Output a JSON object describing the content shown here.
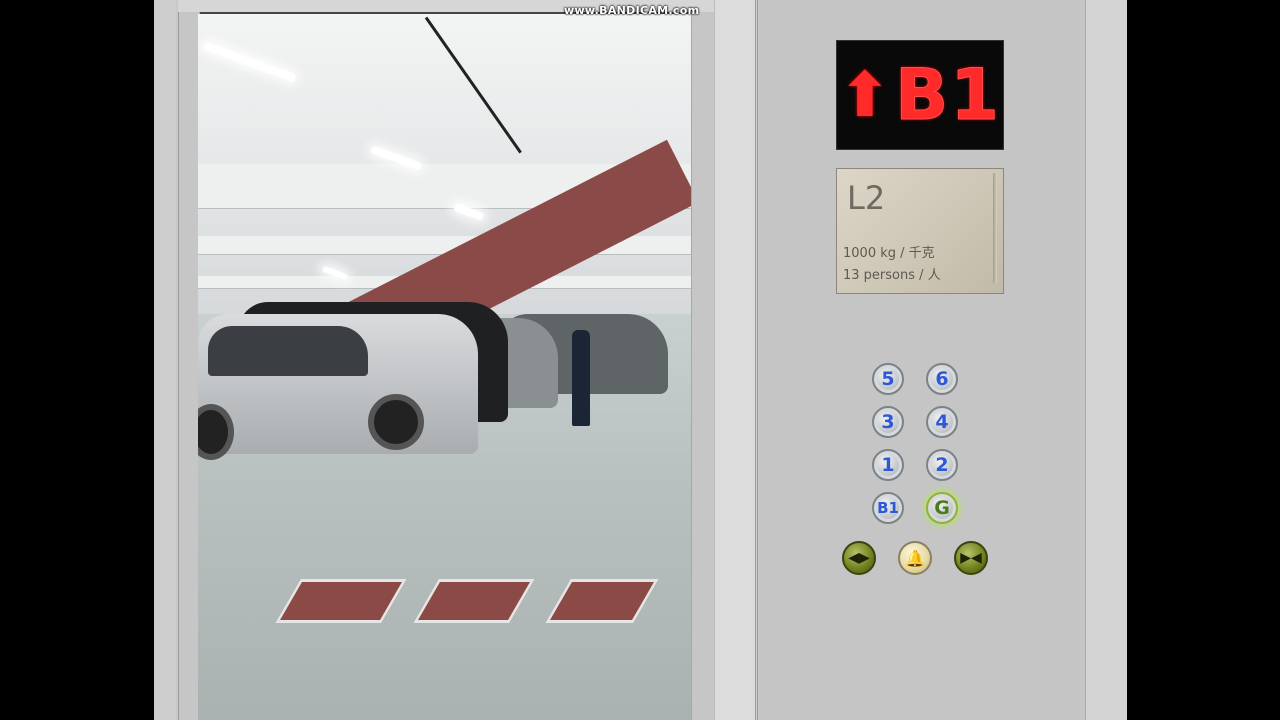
{
  "watermark": "www.BANDICAM.com",
  "indicator": {
    "direction_arrow": "⬆",
    "floor": "B1",
    "color": "#ff2a2a"
  },
  "capacity_plate": {
    "floor_label": "L2",
    "load": "1000 kg / 千克",
    "persons": "13 persons / 人"
  },
  "floor_buttons": [
    {
      "label": "5",
      "lit": false
    },
    {
      "label": "6",
      "lit": false
    },
    {
      "label": "3",
      "lit": false
    },
    {
      "label": "4",
      "lit": false
    },
    {
      "label": "1",
      "lit": false
    },
    {
      "label": "2",
      "lit": false
    },
    {
      "label": "B1",
      "lit": false
    },
    {
      "label": "G",
      "lit": true
    }
  ],
  "control_buttons": [
    {
      "icon": "door-close-icon",
      "glyph": "◀▶"
    },
    {
      "icon": "alarm-bell-icon",
      "glyph": "🔔"
    },
    {
      "icon": "door-open-icon",
      "glyph": "▶◀"
    }
  ],
  "colors": {
    "button_label": "#2d58d8",
    "lit_glow": "#b7e06a",
    "panel": "#c5c5c5"
  }
}
